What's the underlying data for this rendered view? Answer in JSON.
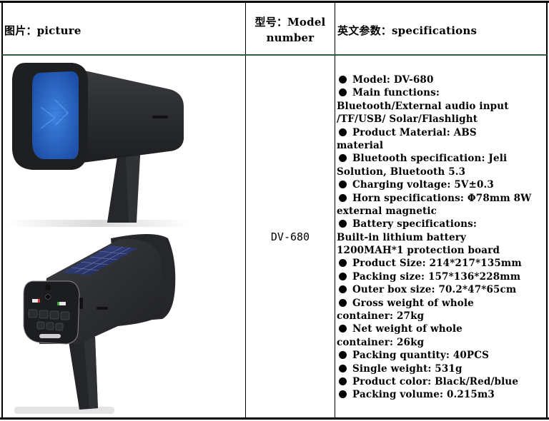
{
  "table": {
    "headers": {
      "picture": "图片：picture",
      "model_line1": "型号：Model",
      "model_line2": "number",
      "specifications": "英文参数：specifications"
    },
    "row": {
      "model_number": "DV-680",
      "images": [
        {
          "name": "megaphone-front-view",
          "description": "Black megaphone with blue speaker grille and pistol grip handle"
        },
        {
          "name": "megaphone-rear-view",
          "description": "Black megaphone with solar panel on top, control button panel on back, pistol grip handle"
        }
      ],
      "spec_lines": [
        {
          "bullet": true,
          "text": "Model: DV-680"
        },
        {
          "bullet": true,
          "text": "Main functions:"
        },
        {
          "bullet": false,
          "text": "Bluetooth/External audio input"
        },
        {
          "bullet": false,
          "text": "/TF/USB/ Solar/Flashlight"
        },
        {
          "bullet": true,
          "text": "Product Material: ABS"
        },
        {
          "bullet": false,
          "text": "material"
        },
        {
          "bullet": true,
          "text": "Bluetooth specification: Jeli"
        },
        {
          "bullet": false,
          "text": "Solution, Bluetooth 5.3"
        },
        {
          "bullet": true,
          "text": "Charging voltage: 5V±0.3"
        },
        {
          "bullet": true,
          "text": "Horn specifications: Φ78mm 8W"
        },
        {
          "bullet": false,
          "text": "external magnetic"
        },
        {
          "bullet": true,
          "text": "Battery specifications:"
        },
        {
          "bullet": false,
          "text": "Built-in lithium battery"
        },
        {
          "bullet": false,
          "text": "1200MAH*1 protection board"
        },
        {
          "bullet": true,
          "text": "Product Size: 214*217*135mm"
        },
        {
          "bullet": true,
          "text": "Packing size: 157*136*228mm"
        },
        {
          "bullet": true,
          "text": "Outer box size: 70.2*47*65cm"
        },
        {
          "bullet": true,
          "text": "Gross weight of whole"
        },
        {
          "bullet": false,
          "text": "container: 27kg"
        },
        {
          "bullet": true,
          "text": "Net weight of whole"
        },
        {
          "bullet": false,
          "text": "container: 26kg"
        },
        {
          "bullet": true,
          "text": "Packing quantity: 40PCS"
        },
        {
          "bullet": true,
          "text": "Single weight: 531g"
        },
        {
          "bullet": true,
          "text": "Product color: Black/Red/blue"
        },
        {
          "bullet": true,
          "text": "Packing volume: 0.215m3"
        }
      ]
    }
  },
  "colors": {
    "grille_blue": "#2f6fd0",
    "body_dark": "#2b2d30",
    "header_divider": "#2e5e3e",
    "solar_panel": "#2a3560"
  }
}
